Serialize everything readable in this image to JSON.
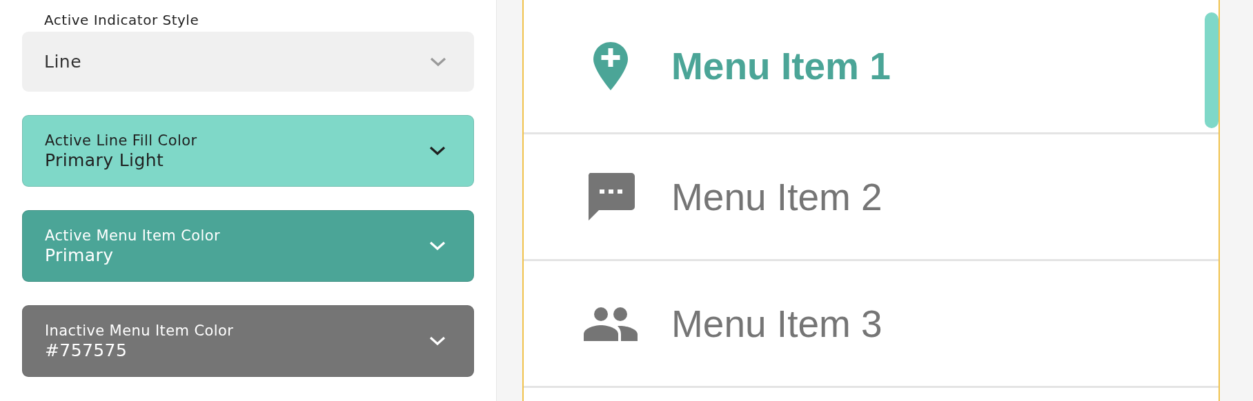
{
  "settings": {
    "heading": "Active Indicator Style",
    "fields": [
      {
        "kind": "select",
        "value": "Line"
      },
      {
        "kind": "color",
        "label": "Active Line Fill Color",
        "value": "Primary Light",
        "color": "#7fd8c8"
      },
      {
        "kind": "color",
        "label": "Active Menu Item Color",
        "value": "Primary",
        "color": "#4ba597"
      },
      {
        "kind": "color",
        "label": "Inactive Menu Item Color",
        "value": "#757575",
        "color": "#757575"
      }
    ]
  },
  "preview": {
    "menu_items": [
      {
        "label": "Menu Item 1",
        "selected": true
      },
      {
        "label": "Menu Item 2",
        "selected": false
      },
      {
        "label": "Menu Item 3",
        "selected": false
      }
    ]
  }
}
